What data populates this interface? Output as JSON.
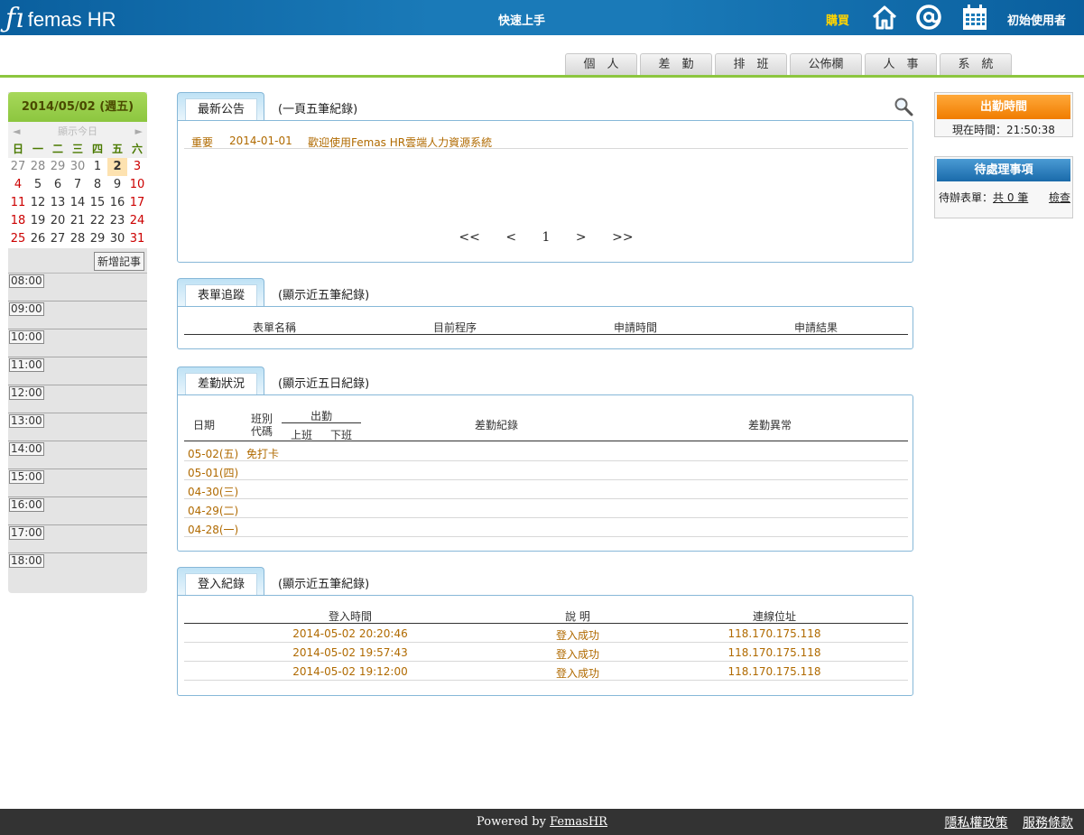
{
  "header": {
    "logo_mark": "ƒı",
    "logo_text": "femas HR",
    "quickstart": "快速上手",
    "buy": "購買",
    "user": "初始使用者"
  },
  "nav": [
    "個　人",
    "差　勤",
    "排　班",
    "公佈欄",
    "人　事",
    "系　統"
  ],
  "calendar": {
    "title": "2014/05/02 (週五)",
    "prev": "◄",
    "today": "顯示今日",
    "next": "►",
    "dow": [
      "日",
      "一",
      "二",
      "三",
      "四",
      "五",
      "六"
    ],
    "weeks": [
      [
        "27",
        "28",
        "29",
        "30",
        "1",
        "2",
        "3"
      ],
      [
        "4",
        "5",
        "6",
        "7",
        "8",
        "9",
        "10"
      ],
      [
        "11",
        "12",
        "13",
        "14",
        "15",
        "16",
        "17"
      ],
      [
        "18",
        "19",
        "20",
        "21",
        "22",
        "23",
        "24"
      ],
      [
        "25",
        "26",
        "27",
        "28",
        "29",
        "30",
        "31"
      ]
    ],
    "add_note": "新增記事",
    "slots": [
      "08:00",
      "09:00",
      "10:00",
      "11:00",
      "12:00",
      "13:00",
      "14:00",
      "15:00",
      "16:00",
      "17:00",
      "18:00"
    ]
  },
  "announcements": {
    "tab": "最新公告",
    "subtitle": "(一頁五筆紀錄)",
    "items": [
      {
        "level": "重要",
        "date": "2014-01-01",
        "title": "歡迎使用Femas HR雲端人力資源系統"
      }
    ],
    "pager": {
      "first": "<<",
      "prev": "<",
      "page": "1",
      "next": ">",
      "last": ">>"
    }
  },
  "forms": {
    "tab": "表單追蹤",
    "subtitle": "(顯示近五筆紀錄)",
    "columns": [
      "表單名稱",
      "目前程序",
      "申請時間",
      "申請結果"
    ]
  },
  "attendance": {
    "tab": "差勤狀況",
    "subtitle": "(顯示近五日紀錄)",
    "columns": {
      "date": "日期",
      "shift_a": "班別",
      "shift_b": "代碼",
      "work": "出勤",
      "in": "上班",
      "out": "下班",
      "record": "差勤紀錄",
      "anomaly": "差勤異常"
    },
    "rows": [
      {
        "date": "05-02(五)",
        "shift": "免打卡"
      },
      {
        "date": "05-01(四)",
        "shift": ""
      },
      {
        "date": "04-30(三)",
        "shift": ""
      },
      {
        "date": "04-29(二)",
        "shift": ""
      },
      {
        "date": "04-28(一)",
        "shift": ""
      }
    ]
  },
  "login": {
    "tab": "登入紀錄",
    "subtitle": "(顯示近五筆紀錄)",
    "columns": [
      "登入時間",
      "說 明",
      "連線位址"
    ],
    "rows": [
      {
        "time": "2014-05-02 20:20:46",
        "desc": "登入成功",
        "ip": "118.170.175.118"
      },
      {
        "time": "2014-05-02 19:57:43",
        "desc": "登入成功",
        "ip": "118.170.175.118"
      },
      {
        "time": "2014-05-02 19:12:00",
        "desc": "登入成功",
        "ip": "118.170.175.118"
      }
    ]
  },
  "clock": {
    "title": "出勤時間",
    "label": "現在時間：",
    "time": "21:50:38"
  },
  "pending": {
    "title": "待處理事項",
    "label": "待辦表單：",
    "count": "共 0 筆",
    "view": "檢查"
  },
  "footer": {
    "powered": "Powered by",
    "brand": "FemasHR",
    "privacy": "隱私權政策",
    "terms": "服務條款"
  },
  "colors": {
    "header": "#1a7ab8",
    "accent_green": "#8cc63f",
    "link_orange": "#b06a00",
    "buy_yellow": "#ffd400"
  }
}
